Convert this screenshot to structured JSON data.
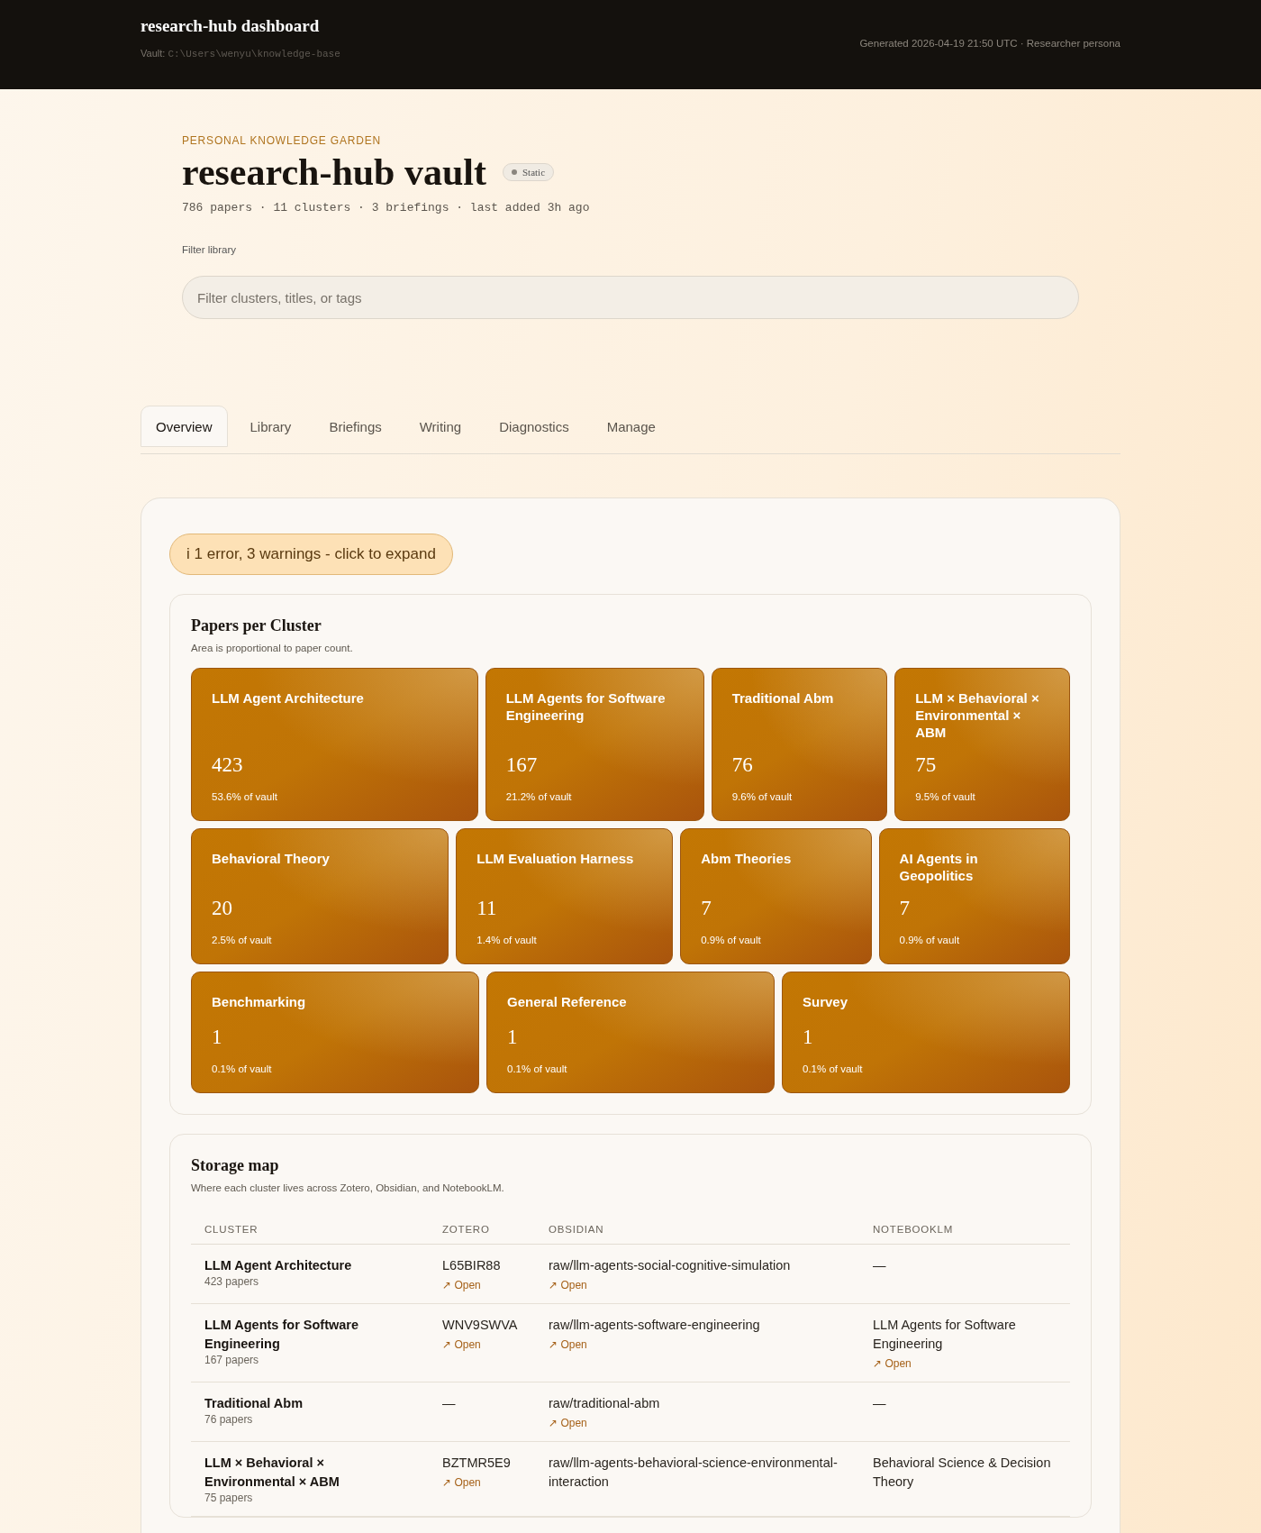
{
  "header": {
    "title": "research-hub dashboard",
    "vault_label": "Vault:",
    "vault_path": "C:\\Users\\wenyu\\knowledge-base",
    "generated": "Generated 2026-04-19 21:50 UTC · Researcher persona"
  },
  "hero": {
    "eyebrow": "PERSONAL KNOWLEDGE GARDEN",
    "title": "research-hub vault",
    "badge": "Static",
    "stats": "786 papers · 11 clusters · 3 briefings · last added 3h ago",
    "filter_label": "Filter library",
    "filter": {
      "placeholder": "Filter clusters, titles, or tags"
    }
  },
  "tabs": [
    {
      "label": "Overview",
      "selected": true
    },
    {
      "label": "Library",
      "selected": false
    },
    {
      "label": "Briefings",
      "selected": false
    },
    {
      "label": "Writing",
      "selected": false
    },
    {
      "label": "Diagnostics",
      "selected": false
    },
    {
      "label": "Manage",
      "selected": false
    }
  ],
  "alert": {
    "icon": "i",
    "text": "1 error, 3 warnings - click to expand"
  },
  "treemap": {
    "title": "Papers per Cluster",
    "subtitle": "Area is proportional to paper count.",
    "rows": [
      {
        "tiles": [
          {
            "name": "LLM Agent Architecture",
            "count": "423",
            "share": "53.6% of vault"
          },
          {
            "name": "LLM Agents for Software Engineering",
            "count": "167",
            "share": "21.2% of vault"
          },
          {
            "name": "Traditional Abm",
            "count": "76",
            "share": "9.6% of vault"
          },
          {
            "name": "LLM × Behavioral × Environmental × ABM",
            "count": "75",
            "share": "9.5% of vault"
          }
        ]
      },
      {
        "tiles": [
          {
            "name": "Behavioral Theory",
            "count": "20",
            "share": "2.5% of vault"
          },
          {
            "name": "LLM Evaluation Harness",
            "count": "11",
            "share": "1.4% of vault"
          },
          {
            "name": "Abm Theories",
            "count": "7",
            "share": "0.9% of vault"
          },
          {
            "name": "AI Agents in Geopolitics",
            "count": "7",
            "share": "0.9% of vault"
          }
        ]
      },
      {
        "tiles": [
          {
            "name": "Benchmarking",
            "count": "1",
            "share": "0.1% of vault"
          },
          {
            "name": "General Reference",
            "count": "1",
            "share": "0.1% of vault"
          },
          {
            "name": "Survey",
            "count": "1",
            "share": "0.1% of vault"
          }
        ]
      }
    ]
  },
  "storage": {
    "title": "Storage map",
    "subtitle": "Where each cluster lives across Zotero, Obsidian, and NotebookLM.",
    "columns": [
      "CLUSTER",
      "ZOTERO",
      "OBSIDIAN",
      "NOTEBOOKLM"
    ],
    "rows": [
      {
        "cells": [
          {
            "value": "LLM Agent Architecture",
            "note": "423 papers"
          },
          {
            "value": "L65BIR88",
            "link": "↗ Open"
          },
          {
            "value": "raw/llm-agents-social-cognitive-simulation",
            "link": "↗ Open"
          },
          {
            "value": "—"
          }
        ]
      },
      {
        "cells": [
          {
            "value": "LLM Agents for Software Engineering",
            "note": "167 papers"
          },
          {
            "value": "WNV9SWVA",
            "link": "↗ Open"
          },
          {
            "value": "raw/llm-agents-software-engineering",
            "link": "↗ Open"
          },
          {
            "value": "LLM Agents for Software Engineering",
            "link": "↗ Open"
          }
        ]
      },
      {
        "cells": [
          {
            "value": "Traditional Abm",
            "note": "76 papers"
          },
          {
            "value": "—"
          },
          {
            "value": "raw/traditional-abm",
            "link": "↗ Open"
          },
          {
            "value": "—"
          }
        ]
      },
      {
        "cells": [
          {
            "value": "LLM × Behavioral × Environmental × ABM",
            "note": "75 papers"
          },
          {
            "value": "BZTMR5E9",
            "link": "↗ Open"
          },
          {
            "value": "raw/llm-agents-behavioral-science-environmental-interaction"
          },
          {
            "value": "Behavioral Science & Decision Theory"
          }
        ]
      }
    ]
  }
}
